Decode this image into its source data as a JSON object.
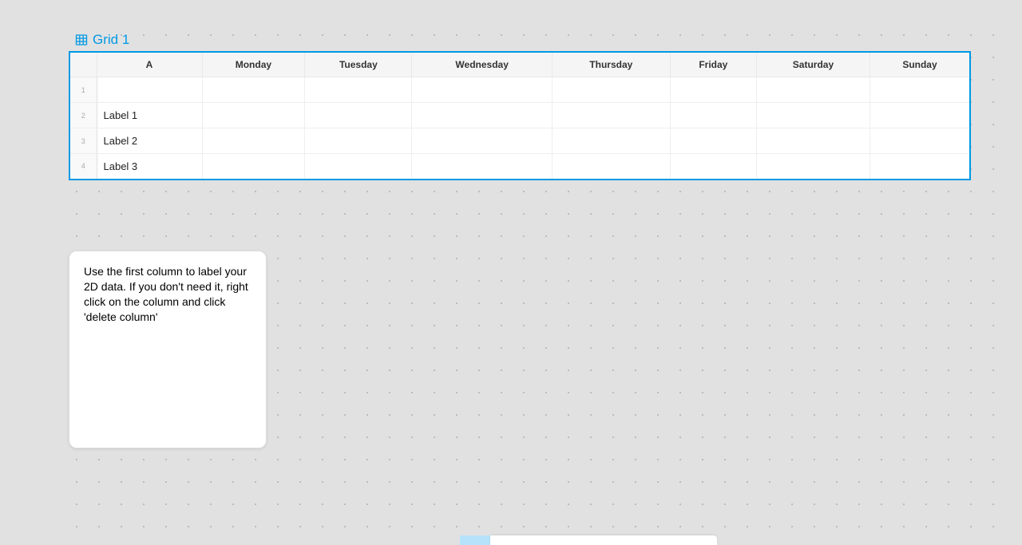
{
  "grid": {
    "title": "Grid 1",
    "columns": [
      "A",
      "Monday",
      "Tuesday",
      "Wednesday",
      "Thursday",
      "Friday",
      "Saturday",
      "Sunday"
    ],
    "rows": [
      {
        "num": "1",
        "cells": [
          "",
          "",
          "",
          "",
          "",
          "",
          "",
          ""
        ]
      },
      {
        "num": "2",
        "cells": [
          "Label 1",
          "",
          "",
          "",
          "",
          "",
          "",
          ""
        ]
      },
      {
        "num": "3",
        "cells": [
          "Label 2",
          "",
          "",
          "",
          "",
          "",
          "",
          ""
        ]
      },
      {
        "num": "4",
        "cells": [
          "Label 3",
          "",
          "",
          "",
          "",
          "",
          "",
          ""
        ]
      }
    ]
  },
  "note": {
    "text": "Use the first column to label your 2D data. If you don't need it, right click on the column and click 'delete column'"
  },
  "colors": {
    "accent": "#0099e5"
  }
}
